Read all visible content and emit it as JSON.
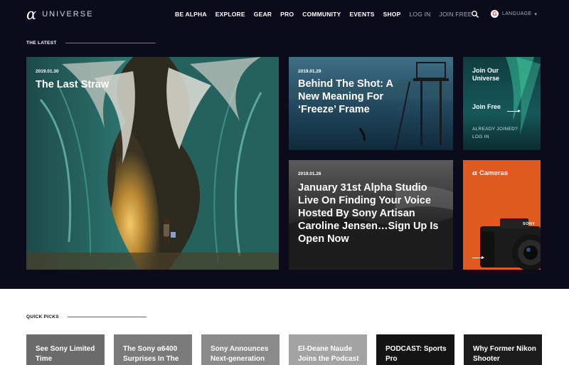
{
  "nav": {
    "brand": "UNIVERSE",
    "links": [
      {
        "label": "BE ALPHA",
        "style": "bold"
      },
      {
        "label": "EXPLORE",
        "style": "bold"
      },
      {
        "label": "GEAR",
        "style": "bold"
      },
      {
        "label": "PRO",
        "style": "bold"
      },
      {
        "label": "COMMUNITY",
        "style": "bold"
      },
      {
        "label": "EVENTS",
        "style": "bold"
      },
      {
        "label": "SHOP",
        "style": "bold"
      },
      {
        "label": "LOG IN",
        "style": "muted"
      },
      {
        "label": "JOIN FREE",
        "style": "muted"
      }
    ],
    "search_icon": "search-icon",
    "language": {
      "icon": "google-icon",
      "icon_glyph": "G",
      "label": "LANGUAGE",
      "chevron": "▾"
    }
  },
  "latest": {
    "heading": "THE LATEST",
    "cards": {
      "main": {
        "date": "2019.01.30",
        "title": "The Last Straw"
      },
      "shot": {
        "date": "2019.01.29",
        "title": "Behind The Shot: A New Meaning For ‘Freeze’ Frame"
      },
      "studio": {
        "date": "2019.01.26",
        "title": "January 31st Alpha Studio Live On Finding Your Voice Hosted By Sony Artisan Caroline Jensen…Sign Up Is Open Now"
      }
    },
    "join": {
      "title": "Join Our Universe",
      "cta": "Join Free",
      "already": "ALREADY JOINED?",
      "login": "LOG IN"
    },
    "cameras": {
      "alpha_glyph": "α",
      "title": "Cameras",
      "brand": "SONY"
    }
  },
  "quick_picks": {
    "heading": "QUICK PICKS",
    "items": [
      {
        "title": "See Sony Limited Time",
        "bg": "#6b6b6b"
      },
      {
        "title": "The Sony α6400 Surprises In The",
        "bg": "#7a7a7a"
      },
      {
        "title": "Sony Announces Next-generation",
        "bg": "#8a8a8a"
      },
      {
        "title": "El-Deane Naude Joins the Podcast",
        "bg": "#a3a3a3"
      },
      {
        "title": "PODCAST: Sports Pro",
        "bg": "#141414"
      },
      {
        "title": "Why Former Nikon Shooter",
        "bg": "#1c1c1c"
      }
    ]
  },
  "colors": {
    "background": "#0b0b1c",
    "orange": "#e05a1f",
    "aurora": "#1c6d6a"
  }
}
